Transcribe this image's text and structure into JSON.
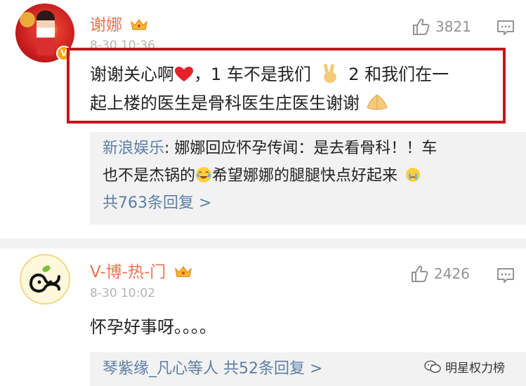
{
  "comments": [
    {
      "username": "谢娜",
      "time": "8-30 10:36",
      "likes": "3821",
      "body_line1_a": "谢谢关心啊",
      "body_line1_b": "，1 车不是我们",
      "body_line1_c": "2 和我们在一",
      "body_line2": "起上楼的医生是骨科医生庄医生谢谢",
      "reply": {
        "author": "新浪娱乐",
        "colon": ": ",
        "line1": "娜娜回应怀孕传闻：是去看骨科！！车",
        "line2_a": "也不是杰锅的",
        "line2_b": "希望娜娜的腿腿快点好起来",
        "more": "共763条回复 >"
      }
    },
    {
      "username": "V-博-热-门",
      "time": "8-30 10:02",
      "likes": "2426",
      "body": "怀孕好事呀。。。。",
      "reply_summary_names": "琴紫缘_凡心等人",
      "reply_summary_count": "共52条回复 >"
    }
  ],
  "watermark": "明星权力榜",
  "icons": [
    "thumbs-up-icon",
    "comment-icon",
    "crown-icon",
    "heart-emoji",
    "victory-hand-emoji",
    "pray-hands-emoji",
    "laugh-cry-emoji",
    "crying-emoji",
    "wechat-icon"
  ],
  "colors": {
    "username": "#eb7350",
    "link": "#5d7fa6",
    "highlight": "#c3161c"
  }
}
